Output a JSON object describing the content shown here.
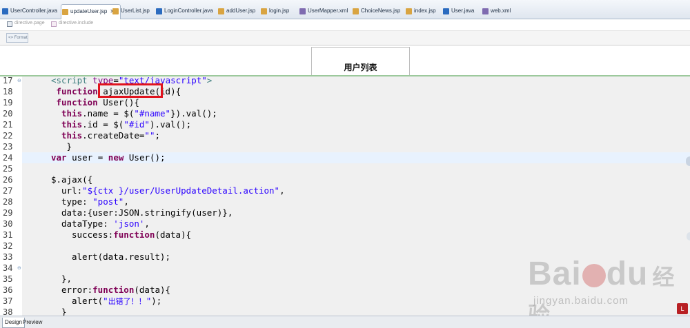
{
  "tabs": [
    {
      "label": "UserController.java",
      "type": "java",
      "active": false
    },
    {
      "label": "updateUser.jsp",
      "type": "jsp",
      "active": true,
      "close": "✕"
    },
    {
      "label": "UserList.jsp",
      "type": "jsp",
      "active": false
    },
    {
      "label": "LoginController.java",
      "type": "java",
      "active": false
    },
    {
      "label": "addUser.jsp",
      "type": "jsp",
      "active": false
    },
    {
      "label": "login.jsp",
      "type": "jsp",
      "active": false
    },
    {
      "label": "UserMapper.xml",
      "type": "xml",
      "active": false
    },
    {
      "label": "ChoiceNews.jsp",
      "type": "jsp",
      "active": false
    },
    {
      "label": "index.jsp",
      "type": "jsp",
      "active": false
    },
    {
      "label": "User.java",
      "type": "java",
      "active": false
    },
    {
      "label": "web.xml",
      "type": "xml",
      "active": false
    }
  ],
  "breadcrumbs": [
    {
      "label": "directive.page",
      "icon": "directive-icon"
    },
    {
      "label": "directive.include",
      "icon": "palette-icon"
    }
  ],
  "design_toolbar": {
    "button_label": "<> Format"
  },
  "preview": {
    "title": "用户列表"
  },
  "editor": {
    "current_line": 24,
    "highlighted_text": "ajaxUpdate(",
    "lines": [
      {
        "n": "17",
        "fold": true,
        "indent": 4,
        "tokens": [
          [
            "tag",
            "<script "
          ],
          [
            "attr",
            "type"
          ],
          [
            "",
            "="
          ],
          [
            "str",
            "\"text/javascript\""
          ],
          [
            "tag",
            ">"
          ]
        ]
      },
      {
        "n": "18",
        "indent": 5,
        "tokens": [
          [
            "kw",
            "function"
          ],
          [
            "",
            " "
          ],
          [
            "fn",
            "ajaxUpdate(id){"
          ]
        ]
      },
      {
        "n": "19",
        "indent": 5,
        "tokens": [
          [
            "kw",
            "function"
          ],
          [
            "",
            " User(){"
          ]
        ]
      },
      {
        "n": "20",
        "indent": 6,
        "tokens": [
          [
            "kw",
            "this"
          ],
          [
            "",
            ".name = $("
          ],
          [
            "str",
            "\"#name\""
          ],
          [
            "",
            "}).val();"
          ]
        ]
      },
      {
        "n": "21",
        "indent": 6,
        "tokens": [
          [
            "kw",
            "this"
          ],
          [
            "",
            ".id = $("
          ],
          [
            "str",
            "\"#id\""
          ],
          [
            "",
            ").val();"
          ]
        ]
      },
      {
        "n": "22",
        "indent": 6,
        "tokens": [
          [
            "kw",
            "this"
          ],
          [
            "",
            ".createDate="
          ],
          [
            "str",
            "\"\""
          ],
          [
            "",
            ";"
          ]
        ]
      },
      {
        "n": "23",
        "indent": 7,
        "tokens": [
          [
            "",
            "}"
          ]
        ]
      },
      {
        "n": "24",
        "indent": 4,
        "tokens": [
          [
            "kw",
            "var"
          ],
          [
            "",
            " user = "
          ],
          [
            "kw",
            "new"
          ],
          [
            "",
            " User();"
          ]
        ]
      },
      {
        "n": "25",
        "indent": 0,
        "tokens": []
      },
      {
        "n": "26",
        "indent": 4,
        "tokens": [
          [
            "",
            "$.ajax({"
          ]
        ]
      },
      {
        "n": "27",
        "indent": 6,
        "tokens": [
          [
            "",
            "url:"
          ],
          [
            "str",
            "\"${ctx }/user/UserUpdateDetail.action\""
          ],
          [
            "",
            ","
          ]
        ]
      },
      {
        "n": "28",
        "indent": 6,
        "tokens": [
          [
            "",
            "type: "
          ],
          [
            "str",
            "\"post\""
          ],
          [
            "",
            ","
          ]
        ]
      },
      {
        "n": "29",
        "indent": 6,
        "tokens": [
          [
            "",
            "data:{user:JSON.stringify(user)},"
          ]
        ]
      },
      {
        "n": "30",
        "indent": 6,
        "tokens": [
          [
            "",
            "dataType: "
          ],
          [
            "str",
            "'json'"
          ],
          [
            "",
            ","
          ]
        ]
      },
      {
        "n": "31",
        "indent": 8,
        "tokens": [
          [
            "",
            "success:"
          ],
          [
            "kw",
            "function"
          ],
          [
            "",
            "(data){"
          ]
        ]
      },
      {
        "n": "32",
        "indent": 0,
        "tokens": []
      },
      {
        "n": "33",
        "indent": 8,
        "tokens": [
          [
            "",
            "alert(data.result);"
          ]
        ]
      },
      {
        "n": "34",
        "fold": true,
        "indent": 0,
        "tokens": []
      },
      {
        "n": "35",
        "indent": 6,
        "tokens": [
          [
            "",
            "},"
          ]
        ]
      },
      {
        "n": "36",
        "indent": 6,
        "tokens": [
          [
            "",
            "error:"
          ],
          [
            "kw",
            "function"
          ],
          [
            "",
            "(data){"
          ]
        ]
      },
      {
        "n": "37",
        "indent": 8,
        "tokens": [
          [
            "",
            "alert("
          ],
          [
            "str",
            "\""
          ],
          [
            "strcn",
            "出错了！！"
          ],
          [
            "str",
            "\""
          ],
          [
            "",
            ");"
          ]
        ]
      },
      {
        "n": "38",
        "indent": 6,
        "tokens": [
          [
            "",
            "}"
          ]
        ]
      }
    ]
  },
  "watermark": {
    "brand": "Bai",
    "brand_tail": "du",
    "brand_cn": "经验",
    "url": "jingyan.baidu.com"
  },
  "bottom_tabs": [
    {
      "label": "Design",
      "active": true
    },
    {
      "label": "Preview",
      "active": false
    }
  ]
}
